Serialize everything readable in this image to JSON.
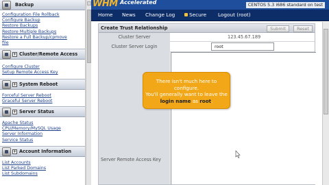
{
  "sidebar": {
    "sections": [
      {
        "title": "Backup",
        "items": [
          "Configuration File Rollback",
          "Configure Backup",
          "Restore Backups",
          "Restore Multiple Backups",
          "Restore a Full Backup/cpmove",
          "file"
        ]
      },
      {
        "title": "Cluster/Remote Access",
        "items": [
          "Configure Cluster",
          "Setup Remote Access Key"
        ]
      },
      {
        "title": "System Reboot",
        "items": [
          "Forceful Server Reboot",
          "Graceful Server Reboot"
        ]
      },
      {
        "title": "Server Status",
        "items": [
          "Apache Status",
          "CPU/Memory/MySQL Usage",
          "Server Information",
          "Service Status"
        ]
      },
      {
        "title": "Account Information",
        "items": [
          "List Accounts",
          "List Parked Domains",
          "List Subdomains"
        ]
      }
    ]
  },
  "banner": {
    "logo": "WHM",
    "logo_sub": "Accelerated",
    "server_info": "CENTOS 5.3 i686 standard on test"
  },
  "nav": {
    "items": [
      "Home",
      "News",
      "Change Log",
      "Secure",
      "Logout (root)"
    ]
  },
  "main": {
    "title": "Create Trust Relationship",
    "submit_label": "Submit",
    "reset_label": "Reset",
    "cluster_server_label": "Cluster Server",
    "cluster_server_value": "123.45.67.189",
    "login_label": "Cluster Server Login",
    "login_value": "root",
    "access_key_label": "Server Remote Access Key"
  },
  "tooltip": {
    "line1": "There isn't much here to configure.",
    "line2": "You'll generally want to leave the",
    "hl1": "login name",
    "mid": " as ",
    "hl2": "root",
    "end": "."
  },
  "colors": {
    "banner": "#1e4e9c",
    "navbar": "#0d2d69",
    "logo": "#f3b52a",
    "tooltip": "#f2a718",
    "link": "#1d3f8a"
  }
}
